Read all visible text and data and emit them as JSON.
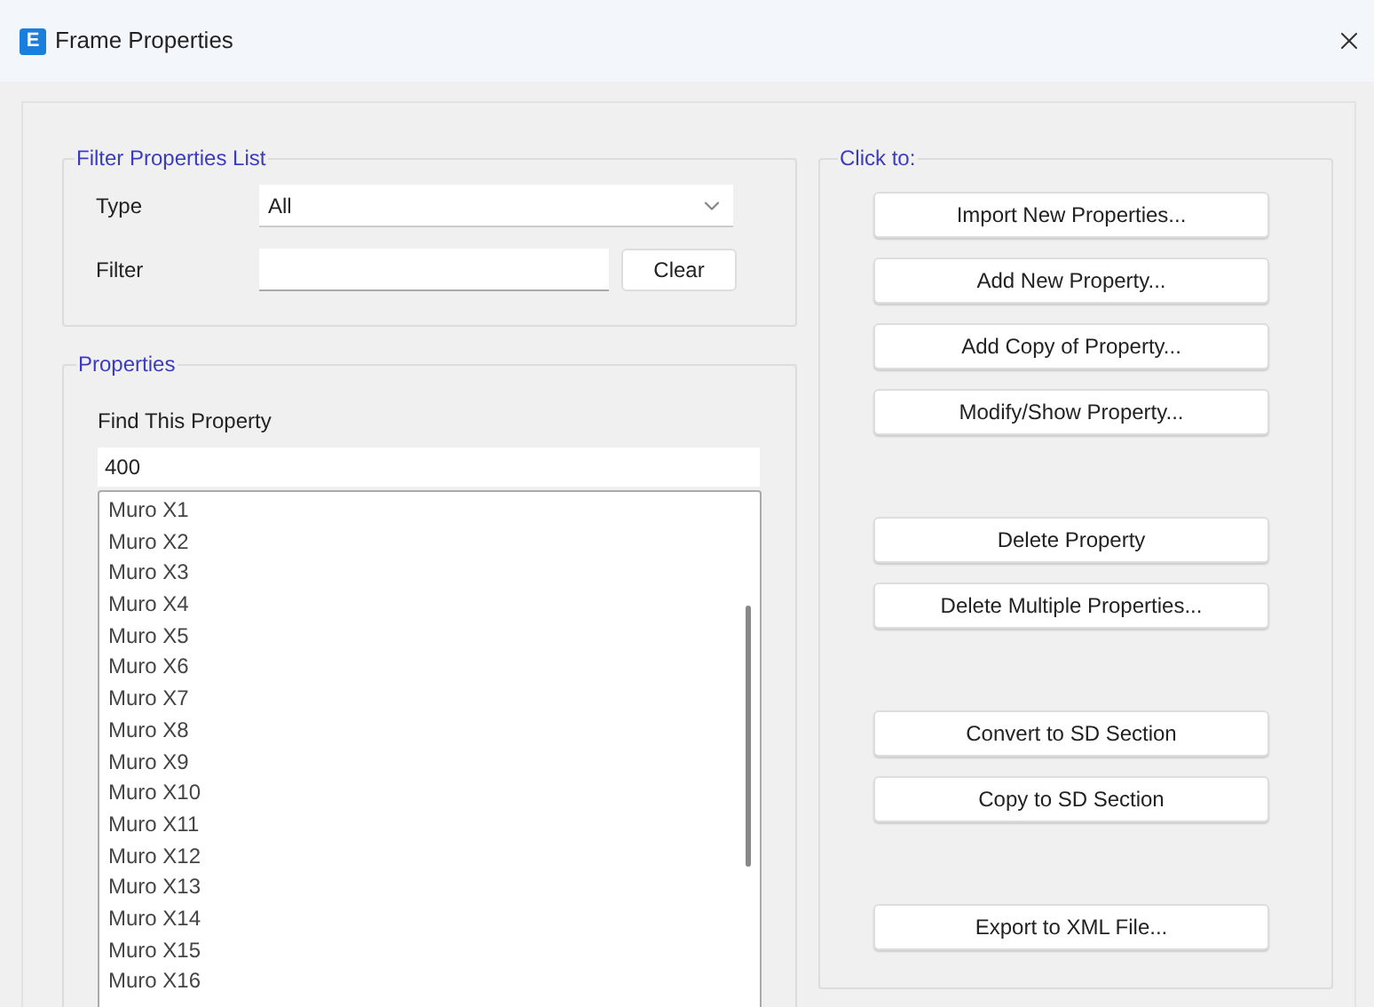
{
  "window": {
    "title": "Frame Properties",
    "app_icon_letter": "E"
  },
  "filter_group": {
    "title": "Filter Properties List",
    "type_label": "Type",
    "type_value": "All",
    "filter_label": "Filter",
    "clear_button": "Clear"
  },
  "properties_group": {
    "title": "Properties",
    "find_label": "Find This Property",
    "find_value": "400",
    "items": [
      "Muro X1",
      "Muro X2",
      "Muro X3",
      "Muro X4",
      "Muro X5",
      "Muro X6",
      "Muro X7",
      "Muro X8",
      "Muro X9",
      "Muro X10",
      "Muro X11",
      "Muro X12",
      "Muro X13",
      "Muro X14",
      "Muro X15",
      "Muro X16"
    ]
  },
  "actions_group": {
    "title": "Click to:",
    "button_groups": [
      [
        "Import New Properties...",
        "Add New Property...",
        "Add Copy of Property...",
        "Modify/Show Property..."
      ],
      [
        "Delete Property",
        "Delete Multiple Properties..."
      ],
      [
        "Convert to SD Section",
        "Copy to SD Section"
      ],
      [
        "Export to XML File..."
      ]
    ]
  }
}
